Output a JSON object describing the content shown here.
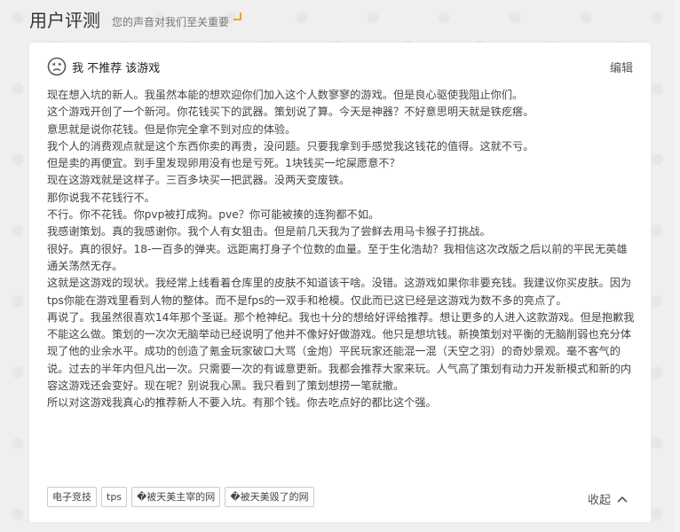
{
  "header": {
    "title": "用户评测",
    "subtitle": "您的声音对我们至关重要"
  },
  "review": {
    "verdict": "我 不推荐 该游戏",
    "edit_label": "编辑",
    "paragraphs": [
      "现在想入坑的新人。我虽然本能的想欢迎你们加入这个人数寥寥的游戏。但是良心驱使我阻止你们。",
      "这个游戏开创了一个新河。你花钱买下的武器。策划说了算。今天是神器？不好意思明天就是铁疙瘩。",
      "意思就是说你花钱。但是你完全拿不到对应的体验。",
      "我个人的消费观点就是这个东西你卖的再贵，没问题。只要我拿到手感觉我这钱花的值得。这就不亏。",
      "但是卖的再便宜。到手里发现卵用没有也是亏死。1块钱买一坨屎愿意不？",
      "现在这游戏就是这样子。三百多块买一把武器。没两天变废铁。",
      "那你说我不花钱行不。",
      "不行。你不花钱。你pvp被打成狗。pve？你可能被揍的连狗都不如。",
      "我感谢策划。真的我感谢你。我个人有女狙击。但是前几天我为了尝鲜去用马卡猴子打挑战。",
      "很好。真的很好。18-一百多的弹夹。远距离打身子个位数的血量。至于生化浩劫？我相信这次改版之后以前的平民无英雄通关荡然无存。",
      "这就是这游戏的现状。我经常上线看着仓库里的皮肤不知道该干啥。没错。这游戏如果你非要充钱。我建议你买皮肤。因为tps你能在游戏里看到人物的整体。而不是fps的一双手和枪模。仅此而已这已经是这游戏为数不多的亮点了。",
      "再说了。我虽然很喜欢14年那个圣诞。那个枪神纪。我也十分的想给好评给推荐。想让更多的人进入这款游戏。但是抱歉我不能这么做。策划的一次次无脑举动已经说明了他并不像好好做游戏。他只是想坑钱。新换策划对平衡的无脑削弱也充分体现了他的业余水平。成功的创造了氪金玩家破口大骂（金炮）平民玩家还能混一混（天空之羽）的奇妙景观。毫不客气的说。过去的半年内但凡出一次。只需要一次的有诚意更新。我都会推荐大家来玩。人气高了策划有动力开发新模式和新的内容这游戏还会变好。现在呢？别说我心黑。我只看到了策划想捞一笔就撤。",
      "所以对这游戏我真心的推荐新人不要入坑。有那个钱。你去吃点好的都比这个强。"
    ],
    "tags": [
      "电子竞技",
      "tps",
      "�被天美主宰的网",
      "�被天美毁了的网"
    ],
    "collapse_label": "收起",
    "icons": {
      "verdict": "sad-face-icon",
      "collapse": "chevron-up-icon"
    },
    "colors": {
      "accent": "#f0a400"
    }
  }
}
